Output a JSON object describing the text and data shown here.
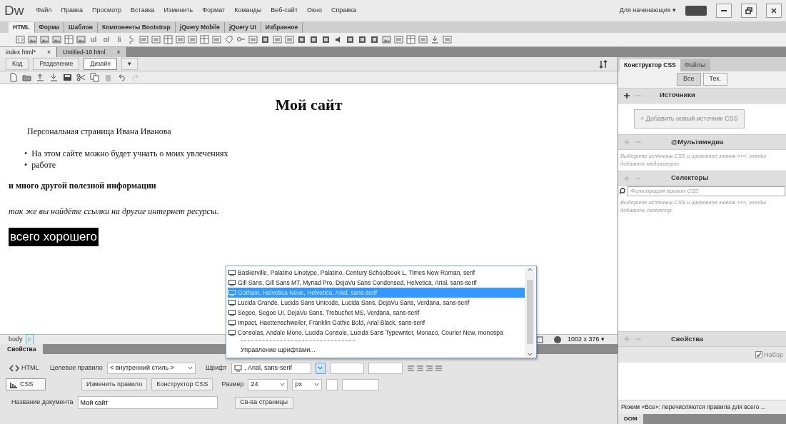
{
  "app": {
    "logo": "Dw",
    "menu": [
      "Файл",
      "Правка",
      "Просмотр",
      "Вставка",
      "Изменить",
      "Формат",
      "Команды",
      "Веб-сайт",
      "Окно",
      "Справка"
    ],
    "workspace": "Для начинающих",
    "workspace_caret": "▾"
  },
  "insert_tabs": [
    {
      "label": "HTML",
      "selected": true
    },
    {
      "label": "Форма",
      "selected": false
    },
    {
      "label": "Шаблон",
      "selected": false
    },
    {
      "label": "Компоненты Bootstrap",
      "selected": false
    },
    {
      "label": "jQuery Mobile",
      "selected": false
    },
    {
      "label": "jQuery UI",
      "selected": false
    },
    {
      "label": "Избранное",
      "selected": false
    }
  ],
  "insert_toolbar": {
    "labels": [
      "ul",
      "ol",
      "li"
    ]
  },
  "doc_tabs": [
    {
      "label": "index.html*",
      "close": "×",
      "selected": true
    },
    {
      "label": "Untitled-10.html",
      "close": "×",
      "selected": false
    }
  ],
  "view_buttons": [
    {
      "label": "Код",
      "selected": false
    },
    {
      "label": "Разделение",
      "selected": false
    },
    {
      "label": "Дизайн",
      "selected": true
    }
  ],
  "view_caret": "▾",
  "design": {
    "blocks": [
      {
        "kind": "heading",
        "text": "Мой сайт"
      },
      {
        "kind": "indent",
        "text": "Персональная страница Ивана Иванова"
      },
      {
        "kind": "list",
        "marker": "•",
        "items": [
          "На этом сайте можно будет учнать о моих увлечениях",
          "работе"
        ]
      },
      {
        "kind": "bold",
        "text": "и много другой полезной информации"
      },
      {
        "kind": "italic",
        "text": "так же вы найдёте ссылки на другие интернет ресурсы."
      },
      {
        "kind": "highlight",
        "text": "всего хорошего"
      }
    ]
  },
  "status_bar": {
    "tags": [
      "body",
      "p"
    ],
    "size": "1002 x 376",
    "size_caret": "▾"
  },
  "properties": {
    "tab": "Свойства",
    "modes": [
      {
        "label": "HTML",
        "selected": false
      },
      {
        "label": "CSS",
        "selected": true
      }
    ],
    "target_rule_label": "Целевое правило",
    "target_rule": "< внутренний стиль >",
    "font_label": "Шрифт",
    "font": ", Arial, sans-serif",
    "font_open": true,
    "edit_rule": "Изменить правило",
    "css_designer": "Конструктор CSS",
    "size_label": "Размер",
    "size": "24",
    "unit": "px",
    "doc_title_label": "Название документа",
    "doc_title": "Мой сайт",
    "page_props": "Св-ва страницы"
  },
  "font_dropdown": {
    "items": [
      {
        "label": "Baskerville, Palatino Linotype, Palatino, Century Schoolbook L, Times New Roman, serif",
        "selected": false
      },
      {
        "label": "Gill Sans, Gill Sans MT, Myriad Pro, DejaVu Sans Condensed, Helvetica, Arial, sans-serif",
        "selected": false
      },
      {
        "label": "Gotham, Helvetica Neue, Helvetica, Arial, sans-serif",
        "selected": true
      },
      {
        "label": "Lucida Grande, Lucida Sans Unicode, Lucida Sans, DejaVu Sans, Verdana, sans-serif",
        "selected": false
      },
      {
        "label": "Segoe, Segoe UI, DejaVu Sans, Trebuchet MS, Verdana, sans-serif",
        "selected": false
      },
      {
        "label": "Impact, Haettenschweiler, Franklin Gothic Bold, Arial Black, sans-serif",
        "selected": false
      },
      {
        "label": "Consolas, Andale Mono, Lucida Console, Lucida Sans Typewriter, Monaco, Courier New, monospa",
        "selected": false
      }
    ],
    "manage": "Управление шрифтами..."
  },
  "css_panel": {
    "tabs": [
      {
        "label": "Конструктор CSS",
        "selected": true
      },
      {
        "label": "Файлы",
        "selected": false
      }
    ],
    "filters": [
      {
        "label": "Все",
        "selected": true
      },
      {
        "label": "Тек.",
        "selected": false
      }
    ],
    "sources_title": "Источники",
    "add_source": "+ Добавить новый источник CSS",
    "media_title": "@Мультимедиа",
    "media_hint": "Выберите источник CSS и щелкните значок «+», чтобы добавить медиазапрос.",
    "selectors_title": "Селекторы",
    "filter_placeholder": "Фильтрация правил CSS",
    "selectors_hint": "Выберите источник CSS и щелкните значок «+», чтобы добавить селектор.",
    "properties_title": "Свойства",
    "show_set_label": "Набор",
    "show_set": true,
    "mode_hint": "Режим «Все»: перечисляются правила для всего ...",
    "dom_tab": "DOM"
  }
}
